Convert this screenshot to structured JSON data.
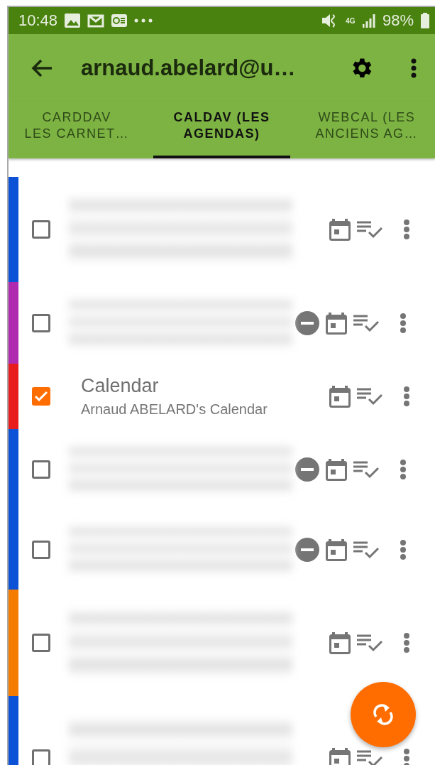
{
  "status_bar": {
    "time": "10:48",
    "network": "4G",
    "battery": "98%"
  },
  "toolbar": {
    "title": "arnaud.abelard@u…"
  },
  "tabs": [
    {
      "label": "CARDDAV\nLES CARNET…",
      "selected": false
    },
    {
      "label": "CALDAV (LES\nAGENDAS)",
      "selected": true
    },
    {
      "label": "WEBCAL (LES\nANCIENS AG…",
      "selected": false
    }
  ],
  "calendars": [
    {
      "color": "#0b52d6",
      "checked": false,
      "read_only": false
    },
    {
      "color": "#b02ab0",
      "checked": false,
      "read_only": true
    },
    {
      "color": "#e81c1c",
      "checked": true,
      "read_only": false,
      "title": "Calendar",
      "subtitle": "Arnaud ABELARD's Calendar"
    },
    {
      "color": "#0b52d6",
      "checked": false,
      "read_only": true
    },
    {
      "color": "#0b52d6",
      "checked": false,
      "read_only": true
    },
    {
      "color": "#f57c00",
      "checked": false,
      "read_only": false
    },
    {
      "color": "#0b52d6",
      "checked": false,
      "read_only": false
    }
  ]
}
